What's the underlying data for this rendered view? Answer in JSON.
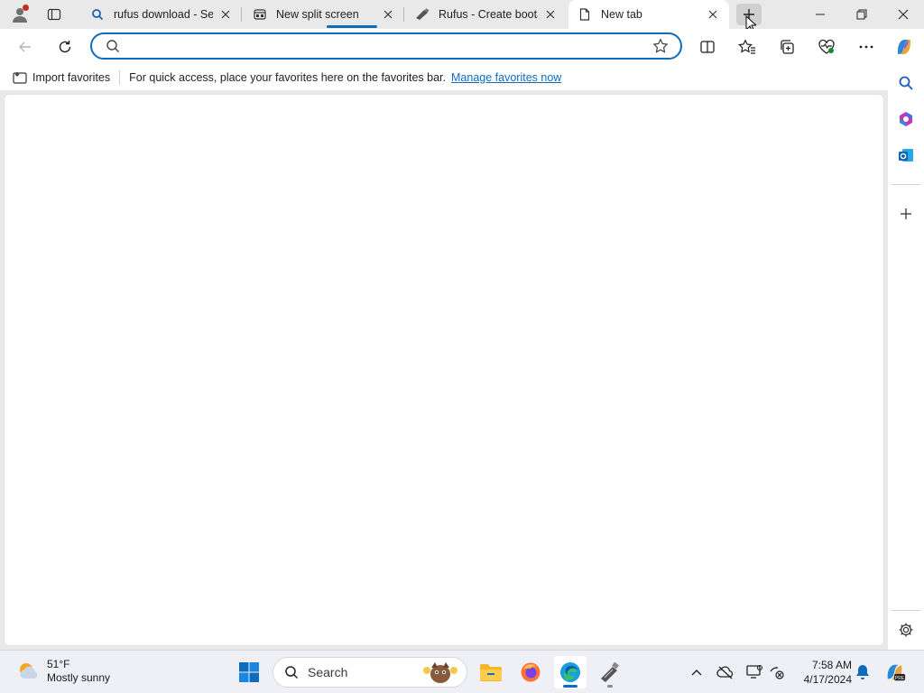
{
  "tabs": [
    {
      "title": "rufus download - Sea",
      "icon": "search-icon"
    },
    {
      "title": "New split screen",
      "icon": "split-screen-icon"
    },
    {
      "title": "Rufus - Create bootab",
      "icon": "rufus-icon"
    },
    {
      "title": "New tab",
      "icon": "page-icon",
      "active": true
    }
  ],
  "addressbar": {
    "value": "",
    "placeholder": ""
  },
  "favorites_bar": {
    "import_label": "Import favorites",
    "hint": "For quick access, place your favorites here on the favorites bar.",
    "manage_link": "Manage favorites now"
  },
  "taskbar": {
    "weather_temp": "51°F",
    "weather_desc": "Mostly sunny",
    "search_label": "Search",
    "time": "7:58 AM",
    "date": "4/17/2024"
  },
  "colors": {
    "accent": "#0f6cbd",
    "titlebar": "#e9e9ea",
    "taskbar": "#eef0f5"
  }
}
